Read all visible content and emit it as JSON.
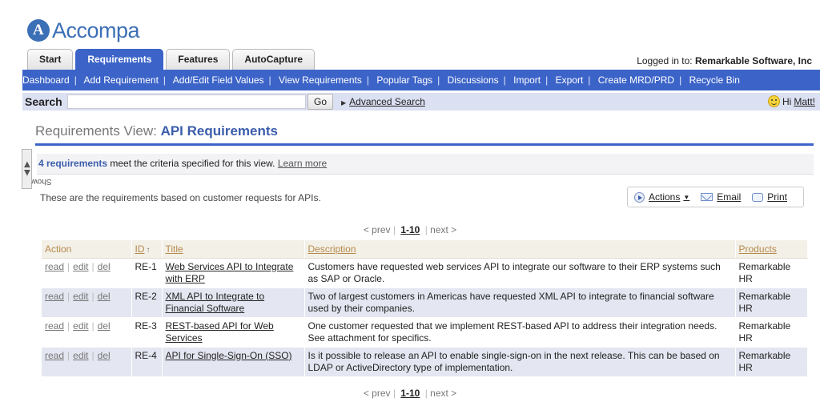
{
  "app": {
    "logo_text": "Accompa"
  },
  "tabs": [
    {
      "label": "Start",
      "active": false
    },
    {
      "label": "Requirements",
      "active": true
    },
    {
      "label": "Features",
      "active": false
    },
    {
      "label": "AutoCapture",
      "active": false
    }
  ],
  "login": {
    "prefix": "Logged in to:",
    "company": "Remarkable Software, Inc"
  },
  "nav": [
    "Dashboard",
    "Add Requirement",
    "Add/Edit Field Values",
    "View Requirements",
    "Popular Tags",
    "Discussions",
    "Import",
    "Export",
    "Create MRD/PRD",
    "Recycle Bin"
  ],
  "search": {
    "label": "Search",
    "value": "",
    "go_label": "Go",
    "advanced_label": "Advanced Search"
  },
  "greeting": {
    "hi": "Hi",
    "user": "Matt!"
  },
  "show_tab": "Show",
  "view": {
    "prefix": "Requirements View:",
    "name": "API Requirements"
  },
  "criteria": {
    "count": "4 requirements",
    "text": "meet the criteria specified for this view.",
    "learn_more": "Learn more"
  },
  "description": "These are the requirements based on customer requests for APIs.",
  "actions": {
    "actions_label": "Actions",
    "email_label": "Email",
    "print_label": "Print"
  },
  "pager": {
    "prev": "< prev",
    "current": "1-10",
    "next": "next >"
  },
  "table": {
    "headers": {
      "action": "Action",
      "id": "ID",
      "title": "Title",
      "description": "Description",
      "products": "Products"
    },
    "row_actions": {
      "read": "read",
      "edit": "edit",
      "del": "del"
    },
    "rows": [
      {
        "id": "RE-1",
        "title": "Web Services API to Integrate with ERP",
        "description": "Customers have requested web services API to integrate our software to their ERP systems such as SAP or Oracle.",
        "products": "Remarkable HR"
      },
      {
        "id": "RE-2",
        "title": "XML API to Integrate to Financial Software",
        "description": "Two of largest customers in Americas have requested XML API to integrate to financial software used by their companies.",
        "products": "Remarkable HR"
      },
      {
        "id": "RE-3",
        "title": "REST-based API for Web Services",
        "description": "One customer requested that we implement REST-based API to address their integration needs. See attachment for specifics.",
        "products": "Remarkable HR"
      },
      {
        "id": "RE-4",
        "title": "API for Single-Sign-On (SSO)",
        "description": "Is it possible to release an API to enable single-sign-on in the next release. This can be based on LDAP or ActiveDirectory type of implementation.",
        "products": "Remarkable HR"
      }
    ]
  },
  "colors": {
    "brand_blue": "#3c64c8",
    "header_text": "#b8894c",
    "row_alt": "#e4e6f1"
  }
}
